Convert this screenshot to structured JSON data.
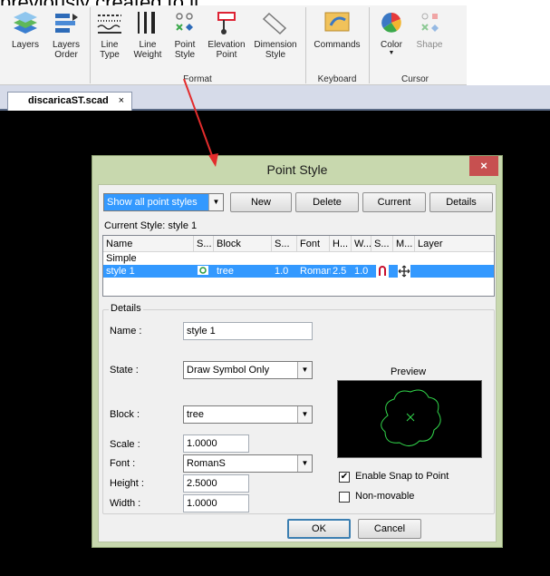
{
  "caption": "previously created to it.",
  "ribbon": {
    "buttons": [
      {
        "label": "Layers",
        "icon": "layers-icon"
      },
      {
        "label": "Layers\nOrder",
        "icon": "layers-order-icon"
      },
      {
        "label": "Line\nType",
        "icon": "line-type-icon"
      },
      {
        "label": "Line\nWeight",
        "icon": "line-weight-icon"
      },
      {
        "label": "Point\nStyle",
        "icon": "point-style-icon"
      },
      {
        "label": "Elevation\nPoint",
        "icon": "elevation-point-icon"
      },
      {
        "label": "Dimension\nStyle",
        "icon": "dimension-style-icon"
      },
      {
        "label": "Commands",
        "icon": "commands-icon"
      },
      {
        "label": "Color",
        "icon": "color-icon"
      },
      {
        "label": "Shape",
        "icon": "shape-icon"
      }
    ],
    "groups": [
      "Format",
      "Keyboard",
      "Cursor"
    ]
  },
  "document_tab": {
    "name": "discaricaST.scad",
    "close": "×"
  },
  "dialog": {
    "title": "Point Style",
    "close": "×",
    "filter": "Show all point styles",
    "buttons": {
      "new": "New",
      "delete": "Delete",
      "current": "Current",
      "details": "Details"
    },
    "current_style_label": "Current Style:",
    "current_style_value": "style 1",
    "columns": [
      "Name",
      "S...",
      "Block",
      "S...",
      "Font",
      "H...",
      "W...",
      "S...",
      "M...",
      "Layer"
    ],
    "rows": [
      {
        "name": "Simple",
        "block": "",
        "scale": "",
        "font": "",
        "height": "",
        "width": ""
      },
      {
        "name": "style 1",
        "block": "tree",
        "scale": "1.0",
        "font": "RomanS",
        "height": "2.5",
        "width": "1.0"
      }
    ],
    "details": {
      "title": "Details",
      "name_label": "Name :",
      "name_value": "style 1",
      "state_label": "State :",
      "state_value": "Draw Symbol Only",
      "block_label": "Block :",
      "block_value": "tree",
      "scale_label": "Scale :",
      "scale_value": "1.0000",
      "font_label": "Font :",
      "font_value": "RomanS",
      "height_label": "Height :",
      "height_value": "2.5000",
      "width_label": "Width :",
      "width_value": "1.0000",
      "preview_label": "Preview",
      "snap_label": "Enable Snap to Point",
      "snap_checked": true,
      "nonmovable_label": "Non-movable",
      "nonmovable_checked": false
    },
    "ok": "OK",
    "cancel": "Cancel"
  },
  "colors": {
    "accent": "#3399ff",
    "dialog_frame": "#c8d8ae",
    "close": "#c75050",
    "arrow": "#e32c2c",
    "preview_symbol": "#32d74b"
  }
}
